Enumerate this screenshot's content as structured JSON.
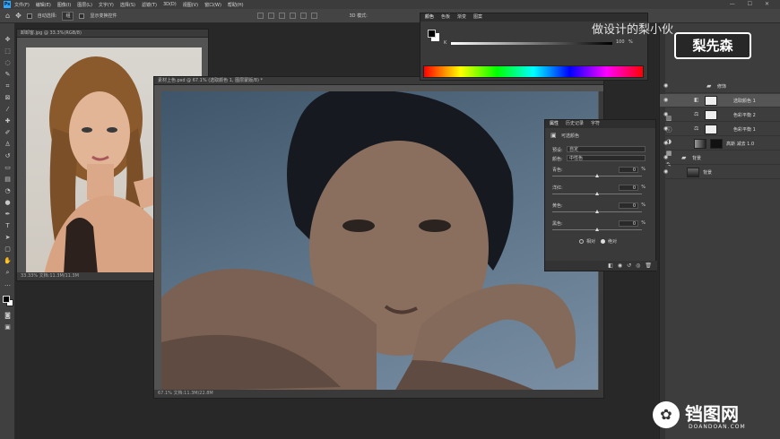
{
  "app": {
    "logo": "Ps"
  },
  "menu": [
    "文件(F)",
    "编辑(E)",
    "图像(I)",
    "图层(L)",
    "文字(Y)",
    "选择(S)",
    "滤镜(T)",
    "3D(D)",
    "视图(V)",
    "窗口(W)",
    "帮助(H)"
  ],
  "window_controls": "— ☐ ✕",
  "options": {
    "auto_select_label": "自动选择:",
    "auto_select_value": "组",
    "transform_label": "显示变换控件",
    "mode_3d": "3D 模式:"
  },
  "doc1": {
    "tab": "卸卸客.jpg @ 33.3%(RGB/8)",
    "status": "33.33%  文档:11.3M/11.3M"
  },
  "doc2": {
    "tab": "素材上色.psd @ 67.1% (选取颜色 1, 图层蒙版/8) *",
    "status": "67.1%  文档:11.3M/22.8M"
  },
  "color_panel": {
    "tabs": [
      "颜色",
      "色板",
      "渐变",
      "图案"
    ],
    "k_label": "K",
    "k_value": "100",
    "k_pct": "%"
  },
  "properties": {
    "tabs": [
      "属性",
      "历史记录",
      "字符"
    ],
    "title": "可选颜色",
    "preset_label": "预设:",
    "preset_value": "自定",
    "colors_label": "颜色:",
    "colors_value": "中性色",
    "sliders": [
      {
        "label": "青色:",
        "value": "0",
        "pos": 0.5
      },
      {
        "label": "洋红:",
        "value": "0",
        "pos": 0.5
      },
      {
        "label": "黄色:",
        "value": "0",
        "pos": 0.5
      },
      {
        "label": "黑色:",
        "value": "0",
        "pos": 0.5
      }
    ],
    "relative": "相对",
    "absolute": "绝对"
  },
  "layers": [
    {
      "name": "修饰",
      "type": "group"
    },
    {
      "name": "选取颜色 1",
      "type": "adjust"
    },
    {
      "name": "色彩平衡 2",
      "type": "adjust"
    },
    {
      "name": "色彩平衡 1",
      "type": "adjust"
    },
    {
      "name": "高斯 减去 1.0",
      "type": "smart"
    },
    {
      "name": "背景",
      "type": "group"
    },
    {
      "name": "背景",
      "type": "image"
    }
  ],
  "watermark": {
    "text": "做设计的梨小伙",
    "badge": "梨先森"
  },
  "site": {
    "name": "铛图网",
    "url": "DOANDOAN.COM"
  },
  "colors": {
    "accent": "#31a8ff",
    "panel": "#3a3a3a",
    "canvas": "#282828"
  }
}
